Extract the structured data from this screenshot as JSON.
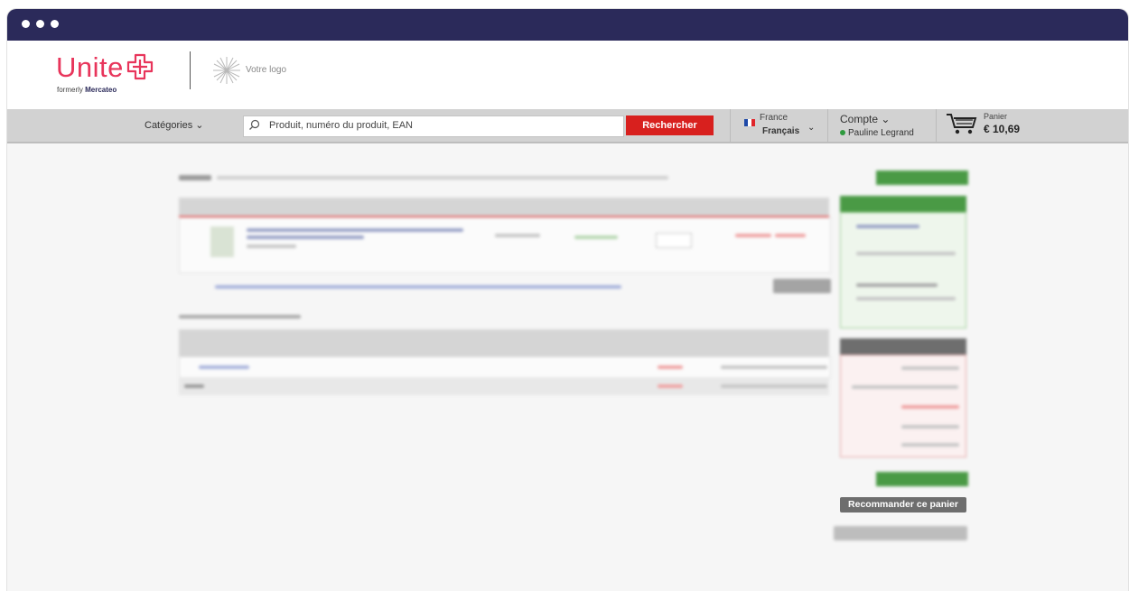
{
  "window": {
    "controls": [
      "close",
      "minimize",
      "maximize"
    ]
  },
  "brand": {
    "name": "Unite",
    "subtitle_prefix": "formerly ",
    "subtitle_brand": "Mercateo",
    "client_logo_text": "Votre logo"
  },
  "nav": {
    "categories_label": "Catégories",
    "search_placeholder": "Produit, numéro du produit, EAN",
    "search_button": "Rechercher",
    "country": "France",
    "language": "Français",
    "account_label": "Compte",
    "user_name": "Pauline Legrand",
    "cart_label": "Panier",
    "cart_total": "€ 10,69"
  },
  "cart_page": {
    "recommend_button": "Recommander ce panier"
  },
  "colors": {
    "titlebar": "#2b2a5a",
    "brand_accent": "#e8355b",
    "search_button": "#d8201e",
    "online": "#2e9a3e",
    "validate_green": "#4a9a45"
  }
}
